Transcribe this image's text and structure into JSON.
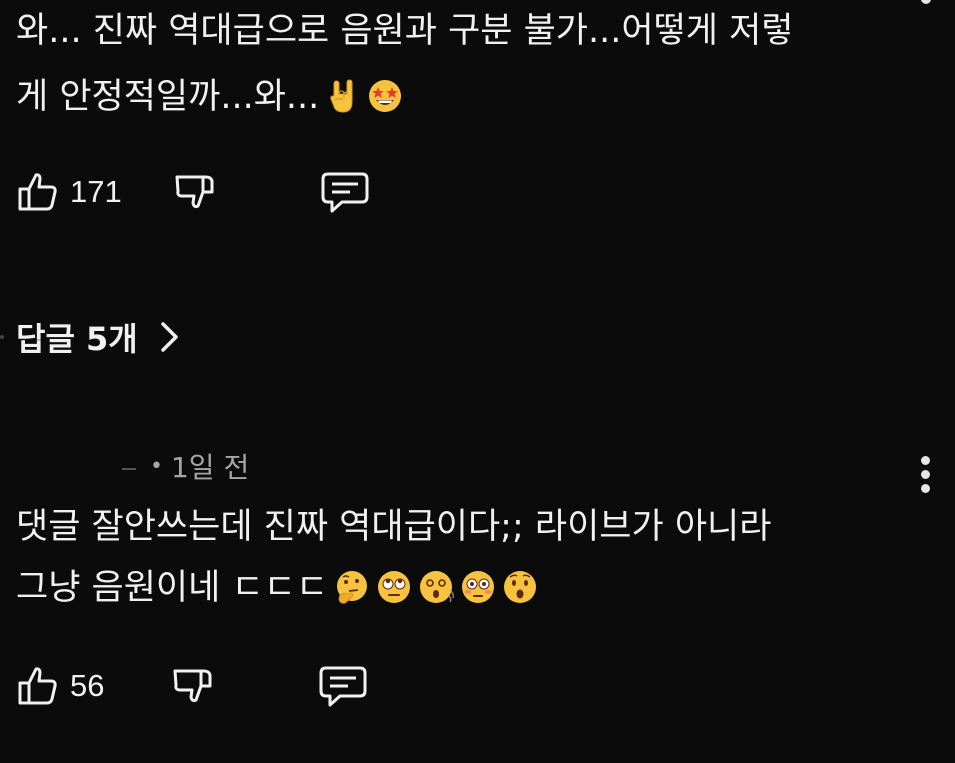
{
  "comment_1": {
    "line_1": "와... 진짜 역대급으로 음원과 구분 불가...어떻게 저렇",
    "line_2": "게 안정적일까...와...",
    "emojis": [
      "rock-hand-emoji",
      "star-struck-emoji"
    ],
    "like_count": "171"
  },
  "replies": {
    "label": "답글 5개"
  },
  "reply_1": {
    "time": "1일 전",
    "line_1": "댓글 잘안쓰는데  진짜 역대급이다;;  라이브가 아니라",
    "line_2": "그냥 음원이네 ㄷㄷㄷ",
    "emojis": [
      "thinking-face-emoji",
      "rolling-eyes-emoji",
      "dizzy-face-emoji",
      "flushed-face-emoji",
      "hushed-face-emoji"
    ],
    "like_count": "56"
  },
  "icons": {
    "like": "thumbs-up-icon",
    "dislike": "thumbs-down-icon",
    "reply": "comment-icon",
    "more": "more-vertical-icon",
    "expand": "chevron-right-icon"
  },
  "colors": {
    "background": "#0b0b0b",
    "text": "#f1f1f1",
    "meta": "#a6a6a6"
  }
}
